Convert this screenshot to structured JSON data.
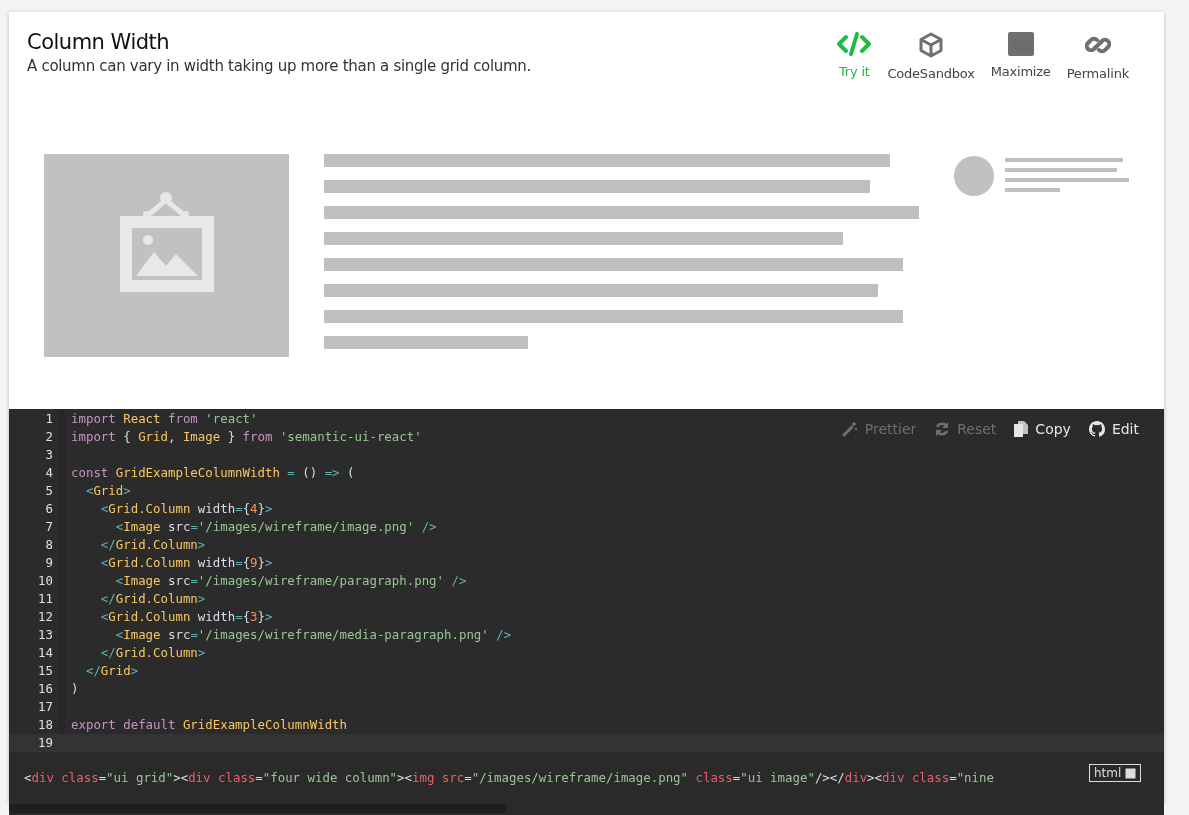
{
  "header": {
    "title": "Column Width",
    "description": "A column can vary in width taking up more than a single grid column."
  },
  "actions": [
    {
      "kind": "code",
      "label": "Try it",
      "selected": true
    },
    {
      "kind": "sandbox",
      "label": "CodeSandbox",
      "selected": false
    },
    {
      "kind": "maximize",
      "label": "Maximize",
      "selected": false
    },
    {
      "kind": "link",
      "label": "Permalink",
      "selected": false
    }
  ],
  "editor_tools": [
    {
      "kind": "wand",
      "label": "Prettier",
      "disabled": true
    },
    {
      "kind": "reset",
      "label": "Reset",
      "disabled": true
    },
    {
      "kind": "copy",
      "label": "Copy",
      "disabled": false
    },
    {
      "kind": "github",
      "label": "Edit",
      "disabled": false
    }
  ],
  "code_lines": [
    {
      "number": "1",
      "tokens": [
        {
          "kind": "keyword",
          "text": "import "
        },
        {
          "kind": "name",
          "text": "React "
        },
        {
          "kind": "keyword",
          "text": "from "
        },
        {
          "kind": "string",
          "text": "'react'"
        }
      ]
    },
    {
      "number": "2",
      "tokens": [
        {
          "kind": "keyword",
          "text": "import "
        },
        {
          "kind": "plain",
          "text": "{ "
        },
        {
          "kind": "name",
          "text": "Grid"
        },
        {
          "kind": "plain",
          "text": ", "
        },
        {
          "kind": "name",
          "text": "Image "
        },
        {
          "kind": "plain",
          "text": "} "
        },
        {
          "kind": "keyword",
          "text": "from "
        },
        {
          "kind": "string",
          "text": "'semantic-ui-react'"
        }
      ]
    },
    {
      "number": "3"
    },
    {
      "number": "4",
      "tokens": [
        {
          "kind": "keyword",
          "text": "const "
        },
        {
          "kind": "name",
          "text": "GridExampleColumnWidth "
        },
        {
          "kind": "punct",
          "text": "= "
        },
        {
          "kind": "plain",
          "text": "() "
        },
        {
          "kind": "punct",
          "text": "=> "
        },
        {
          "kind": "plain",
          "text": "("
        }
      ]
    },
    {
      "number": "5",
      "tokens": [
        {
          "kind": "punct",
          "text": "  <"
        },
        {
          "kind": "name",
          "text": "Grid"
        },
        {
          "kind": "punct",
          "text": ">"
        }
      ]
    },
    {
      "number": "6",
      "tokens": [
        {
          "kind": "punct",
          "text": "    <"
        },
        {
          "kind": "name",
          "text": "Grid.Column "
        },
        {
          "kind": "plain",
          "text": "width"
        },
        {
          "kind": "punct",
          "text": "="
        },
        {
          "kind": "plain",
          "text": "{"
        },
        {
          "kind": "number",
          "text": "4"
        },
        {
          "kind": "plain",
          "text": "}"
        },
        {
          "kind": "punct",
          "text": ">"
        }
      ]
    },
    {
      "number": "7",
      "tokens": [
        {
          "kind": "punct",
          "text": "      <"
        },
        {
          "kind": "name",
          "text": "Image "
        },
        {
          "kind": "plain",
          "text": "src"
        },
        {
          "kind": "punct",
          "text": "="
        },
        {
          "kind": "string",
          "text": "'/images/wireframe/image.png' "
        },
        {
          "kind": "punct",
          "text": "/>"
        }
      ]
    },
    {
      "number": "8",
      "tokens": [
        {
          "kind": "punct",
          "text": "    </"
        },
        {
          "kind": "name",
          "text": "Grid.Column"
        },
        {
          "kind": "punct",
          "text": ">"
        }
      ]
    },
    {
      "number": "9",
      "tokens": [
        {
          "kind": "punct",
          "text": "    <"
        },
        {
          "kind": "name",
          "text": "Grid.Column "
        },
        {
          "kind": "plain",
          "text": "width"
        },
        {
          "kind": "punct",
          "text": "="
        },
        {
          "kind": "plain",
          "text": "{"
        },
        {
          "kind": "number",
          "text": "9"
        },
        {
          "kind": "plain",
          "text": "}"
        },
        {
          "kind": "punct",
          "text": ">"
        }
      ]
    },
    {
      "number": "10",
      "tokens": [
        {
          "kind": "punct",
          "text": "      <"
        },
        {
          "kind": "name",
          "text": "Image "
        },
        {
          "kind": "plain",
          "text": "src"
        },
        {
          "kind": "punct",
          "text": "="
        },
        {
          "kind": "string",
          "text": "'/images/wireframe/paragraph.png' "
        },
        {
          "kind": "punct",
          "text": "/>"
        }
      ]
    },
    {
      "number": "11",
      "tokens": [
        {
          "kind": "punct",
          "text": "    </"
        },
        {
          "kind": "name",
          "text": "Grid.Column"
        },
        {
          "kind": "punct",
          "text": ">"
        }
      ]
    },
    {
      "number": "12",
      "tokens": [
        {
          "kind": "punct",
          "text": "    <"
        },
        {
          "kind": "name",
          "text": "Grid.Column "
        },
        {
          "kind": "plain",
          "text": "width"
        },
        {
          "kind": "punct",
          "text": "="
        },
        {
          "kind": "plain",
          "text": "{"
        },
        {
          "kind": "number",
          "text": "3"
        },
        {
          "kind": "plain",
          "text": "}"
        },
        {
          "kind": "punct",
          "text": ">"
        }
      ]
    },
    {
      "number": "13",
      "tokens": [
        {
          "kind": "punct",
          "text": "      <"
        },
        {
          "kind": "name",
          "text": "Image "
        },
        {
          "kind": "plain",
          "text": "src"
        },
        {
          "kind": "punct",
          "text": "="
        },
        {
          "kind": "string",
          "text": "'/images/wireframe/media-paragraph.png' "
        },
        {
          "kind": "punct",
          "text": "/>"
        }
      ]
    },
    {
      "number": "14",
      "tokens": [
        {
          "kind": "punct",
          "text": "    </"
        },
        {
          "kind": "name",
          "text": "Grid.Column"
        },
        {
          "kind": "punct",
          "text": ">"
        }
      ]
    },
    {
      "number": "15",
      "tokens": [
        {
          "kind": "punct",
          "text": "  </"
        },
        {
          "kind": "name",
          "text": "Grid"
        },
        {
          "kind": "punct",
          "text": ">"
        }
      ]
    },
    {
      "number": "16",
      "tokens": [
        {
          "kind": "plain",
          "text": ")"
        }
      ]
    },
    {
      "number": "17"
    },
    {
      "number": "18",
      "tokens": [
        {
          "kind": "keyword",
          "text": "export "
        },
        {
          "kind": "keyword",
          "text": "default "
        },
        {
          "kind": "name",
          "text": "GridExampleColumnWidth"
        }
      ]
    },
    {
      "number": "19"
    }
  ],
  "html_output": {
    "tokens": [
      {
        "kind": "plain",
        "text": "<"
      },
      {
        "kind": "tag",
        "text": "div "
      },
      {
        "kind": "tag",
        "text": "class"
      },
      {
        "kind": "plain",
        "text": "="
      },
      {
        "kind": "string",
        "text": "\"ui grid\""
      },
      {
        "kind": "plain",
        "text": "><"
      },
      {
        "kind": "tag",
        "text": "div "
      },
      {
        "kind": "tag",
        "text": "class"
      },
      {
        "kind": "plain",
        "text": "="
      },
      {
        "kind": "string",
        "text": "\"four wide column\""
      },
      {
        "kind": "plain",
        "text": "><"
      },
      {
        "kind": "tag",
        "text": "img "
      },
      {
        "kind": "tag",
        "text": "src"
      },
      {
        "kind": "plain",
        "text": "="
      },
      {
        "kind": "string",
        "text": "\"/images/wireframe/image.png\" "
      },
      {
        "kind": "tag",
        "text": "class"
      },
      {
        "kind": "plain",
        "text": "="
      },
      {
        "kind": "string",
        "text": "\"ui image\""
      },
      {
        "kind": "plain",
        "text": "/></"
      },
      {
        "kind": "tag",
        "text": "div"
      },
      {
        "kind": "plain",
        "text": "><"
      },
      {
        "kind": "tag",
        "text": "div "
      },
      {
        "kind": "tag",
        "text": "class"
      },
      {
        "kind": "plain",
        "text": "="
      },
      {
        "kind": "string",
        "text": "\"nine"
      }
    ],
    "badge": "html"
  }
}
